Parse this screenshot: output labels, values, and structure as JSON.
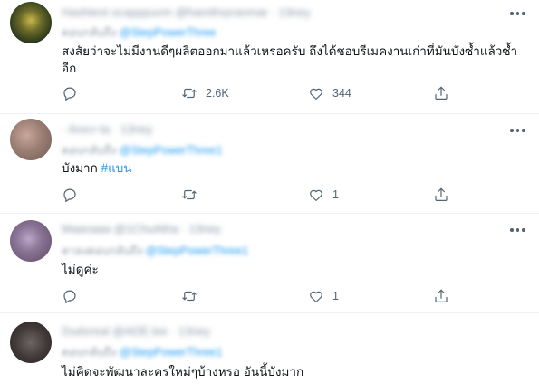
{
  "tweets": [
    {
      "header": "Hashtest ocapppuvm @hamthrpranmar · 13ney",
      "reply_to_prefix": "ตอบกลับถึง",
      "reply_to_handle": "@StepPowerThree",
      "text": "สงสัยว่าจะไม่มีงานดีๆผลิตออกมาแล้วเหรอครับ ถึงได้ชอบรีเมคงานเก่าที่มันบังซ้ำแล้วซ้ำอีก",
      "hashtag": "",
      "reply_count": "",
      "retweet_count": "2.6K",
      "like_count": "344"
    },
    {
      "header": "· Arecr-ta · 13ney",
      "reply_to_prefix": "ตอบกลับถึง",
      "reply_to_handle": "@StepPowerThree1",
      "text": "บังมาก ",
      "hashtag": "#แบน",
      "reply_count": "",
      "retweet_count": "",
      "like_count": "1"
    },
    {
      "header": "Maanaaa @1ChuAtha · 13ney",
      "reply_to_prefix": "ตาลงตอบกลับถึง",
      "reply_to_handle": "@StepPowerThree1",
      "text": "ไม่ดูค่ะ",
      "hashtag": "",
      "reply_count": "",
      "retweet_count": "",
      "like_count": "1"
    },
    {
      "header": "Dudoreal @ADE.lee · 13ney",
      "reply_to_prefix": "ตอบกลับถึง",
      "reply_to_handle": "@StepPowerThree1",
      "text": "ไม่คิดจะพัฒนาละครใหม่ๆบ้างหรอ อันนี้บังมาก",
      "hashtag": "",
      "reply_count": "",
      "retweet_count": "",
      "like_count": ""
    }
  ],
  "icons": {
    "reply": "reply-icon",
    "retweet": "retweet-icon",
    "like": "heart-icon",
    "share": "share-icon",
    "more": "more-icon"
  },
  "colors": {
    "link": "#1d9bf0",
    "text": "#0f1419",
    "muted": "#536471",
    "divider": "#eff3f4"
  }
}
